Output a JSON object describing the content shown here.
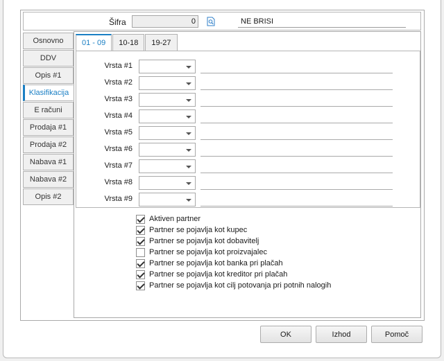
{
  "header": {
    "sifra_label": "Šifra",
    "sifra_value": "0",
    "name_value": "NE BRISI"
  },
  "left_tabs": [
    {
      "label": "Osnovno",
      "active": false
    },
    {
      "label": "DDV",
      "active": false
    },
    {
      "label": "Opis #1",
      "active": false
    },
    {
      "label": "Klasifikacija",
      "active": true
    },
    {
      "label": "E računi",
      "active": false
    },
    {
      "label": "Prodaja #1",
      "active": false
    },
    {
      "label": "Prodaja #2",
      "active": false
    },
    {
      "label": "Nabava #1",
      "active": false
    },
    {
      "label": "Nabava #2",
      "active": false
    },
    {
      "label": "Opis #2",
      "active": false
    }
  ],
  "sub_tabs": [
    {
      "label": "01 - 09",
      "active": true
    },
    {
      "label": "10-18",
      "active": false
    },
    {
      "label": "19-27",
      "active": false
    }
  ],
  "vrsta_rows": [
    {
      "label": "Vrsta #1",
      "value": "",
      "desc": ""
    },
    {
      "label": "Vrsta #2",
      "value": "",
      "desc": ""
    },
    {
      "label": "Vrsta #3",
      "value": "",
      "desc": ""
    },
    {
      "label": "Vrsta #4",
      "value": "",
      "desc": ""
    },
    {
      "label": "Vrsta #5",
      "value": "",
      "desc": ""
    },
    {
      "label": "Vrsta #6",
      "value": "",
      "desc": ""
    },
    {
      "label": "Vrsta #7",
      "value": "",
      "desc": ""
    },
    {
      "label": "Vrsta #8",
      "value": "",
      "desc": ""
    },
    {
      "label": "Vrsta #9",
      "value": "",
      "desc": ""
    }
  ],
  "checkboxes": [
    {
      "label": "Aktiven partner",
      "checked": true
    },
    {
      "label": "Partner se pojavlja kot kupec",
      "checked": true
    },
    {
      "label": "Partner se pojavlja kot dobavitelj",
      "checked": true
    },
    {
      "label": "Partner se pojavlja kot proizvajalec",
      "checked": false
    },
    {
      "label": "Partner se pojavlja kot banka pri plačah",
      "checked": true
    },
    {
      "label": "Partner se pojavlja kot kreditor pri plačah",
      "checked": true
    },
    {
      "label": "Partner se pojavlja kot cilj potovanja pri potnih nalogih",
      "checked": true
    }
  ],
  "buttons": {
    "ok": "OK",
    "exit": "Izhod",
    "help": "Pomoč"
  },
  "colors": {
    "accent": "#1a7fc4"
  },
  "icons": {
    "search": "search-doc-icon",
    "dropdown": "chevron-down-icon"
  }
}
